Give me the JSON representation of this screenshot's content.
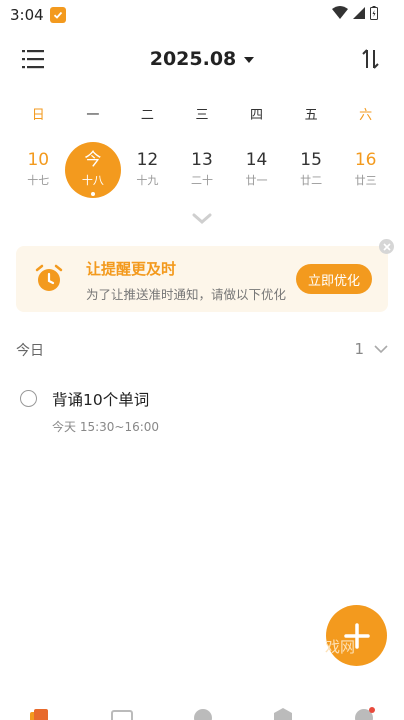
{
  "status_bar": {
    "time": "3:04"
  },
  "header": {
    "month": "2025.08"
  },
  "weekdays": [
    "日",
    "一",
    "二",
    "三",
    "四",
    "五",
    "六"
  ],
  "dates": [
    {
      "num": "10",
      "lunar": "十七"
    },
    {
      "num": "今",
      "lunar": "十八"
    },
    {
      "num": "12",
      "lunar": "十九"
    },
    {
      "num": "13",
      "lunar": "二十"
    },
    {
      "num": "14",
      "lunar": "廿一"
    },
    {
      "num": "15",
      "lunar": "廿二"
    },
    {
      "num": "16",
      "lunar": "廿三"
    }
  ],
  "banner": {
    "title": "让提醒更及时",
    "subtitle": "为了让推送准时通知，请做以下优化",
    "button": "立即优化"
  },
  "section": {
    "title": "今日",
    "count": "1"
  },
  "task": {
    "title": "背诵10个单词",
    "time": "今天 15:30~16:00"
  },
  "watermark": "戏网",
  "colors": {
    "accent": "#f39a1e",
    "banner_bg": "#fdf6ea"
  }
}
